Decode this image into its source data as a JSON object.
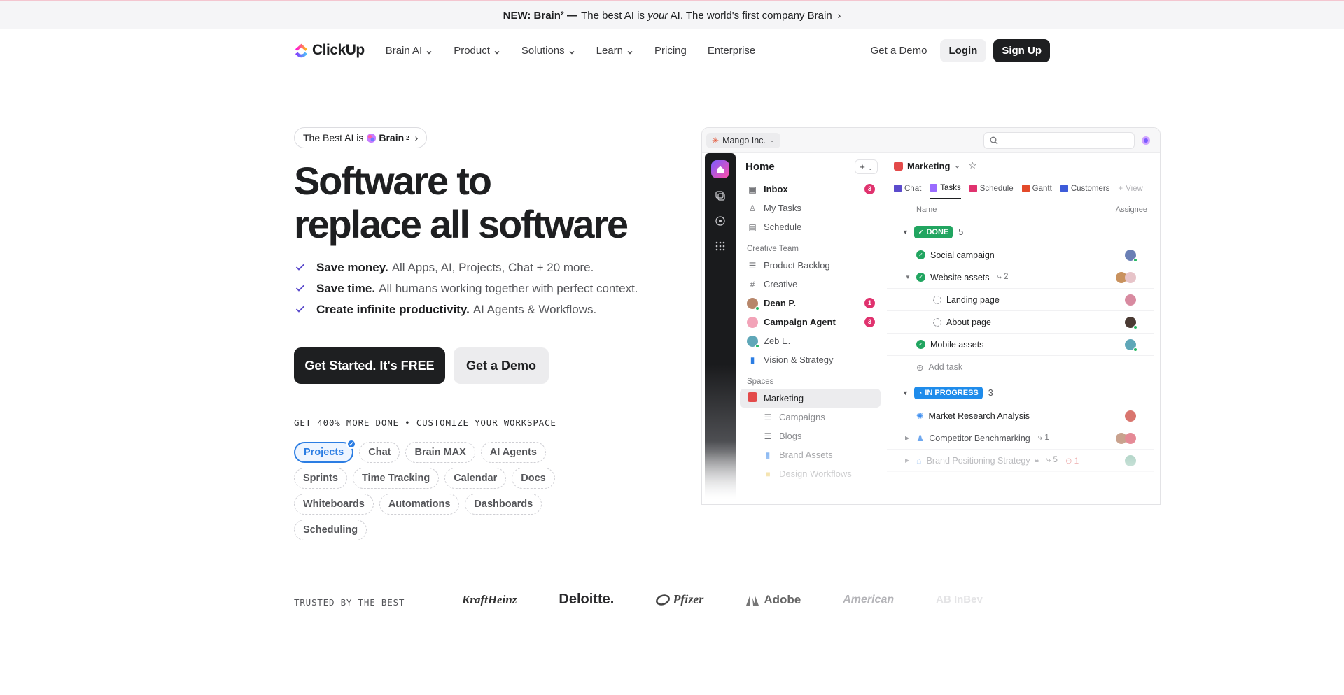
{
  "announcement": {
    "lead": "NEW: Brain² —",
    "text_before": "The best AI is",
    "text_em": "your",
    "text_after": "AI. The world's first company Brain"
  },
  "nav": {
    "logo": "ClickUp",
    "items": [
      {
        "label": "Brain AI",
        "has_caret": true
      },
      {
        "label": "Product",
        "has_caret": true
      },
      {
        "label": "Solutions",
        "has_caret": true
      },
      {
        "label": "Learn",
        "has_caret": true
      },
      {
        "label": "Pricing",
        "has_caret": false
      },
      {
        "label": "Enterprise",
        "has_caret": false
      }
    ],
    "demo": "Get a Demo",
    "login": "Login",
    "signup": "Sign Up"
  },
  "hero": {
    "pill_prefix": "The Best AI is",
    "pill_brand": "Brain",
    "pill_sup": "2",
    "headline_1": "Software to",
    "headline_2": "replace all software",
    "features": [
      {
        "bold": "Save money.",
        "text": "All Apps, AI, Projects, Chat + 20 more."
      },
      {
        "bold": "Save time.",
        "text": "All humans working together with perfect context."
      },
      {
        "bold": "Create infinite productivity.",
        "text": "AI Agents & Workflows."
      }
    ],
    "cta_primary": "Get Started. It's FREE",
    "cta_secondary": "Get a Demo",
    "workspace_label": "GET 400% MORE DONE • CUSTOMIZE YOUR WORKSPACE",
    "chips": [
      "Projects",
      "Chat",
      "Brain MAX",
      "AI Agents",
      "Sprints",
      "Time Tracking",
      "Calendar",
      "Docs",
      "Whiteboards",
      "Automations",
      "Dashboards",
      "Scheduling"
    ]
  },
  "trusted": {
    "label": "TRUSTED BY THE BEST",
    "logos": [
      "KraftHeinz",
      "Deloitte.",
      "Pfizer",
      "Adobe",
      "American",
      "AB InBev"
    ]
  },
  "app": {
    "workspace": "Mango Inc.",
    "sidebar": {
      "title": "Home",
      "top_items": [
        {
          "label": "Inbox",
          "count": "3",
          "bold": true
        },
        {
          "label": "My Tasks"
        },
        {
          "label": "Schedule"
        }
      ],
      "team_label": "Creative Team",
      "team_items": [
        {
          "label": "Product Backlog"
        },
        {
          "label": "Creative"
        },
        {
          "label": "Dean P.",
          "count": "1",
          "bold": true
        },
        {
          "label": "Campaign Agent",
          "count": "3",
          "bold": true
        },
        {
          "label": "Zeb E."
        },
        {
          "label": "Vision & Strategy"
        }
      ],
      "spaces_label": "Spaces",
      "space_items": [
        {
          "label": "Marketing"
        },
        {
          "label": "Campaigns"
        },
        {
          "label": "Blogs"
        },
        {
          "label": "Brand Assets"
        },
        {
          "label": "Design Workflows"
        }
      ]
    },
    "main": {
      "title": "Marketing",
      "tabs": [
        "Chat",
        "Tasks",
        "Schedule",
        "Gantt",
        "Customers",
        "View"
      ],
      "col_name": "Name",
      "col_assignee": "Assignee",
      "done_label": "DONE",
      "done_count": "5",
      "done_tasks": [
        {
          "name": "Social campaign"
        },
        {
          "name": "Website assets",
          "subtasks": "2"
        },
        {
          "name": "Landing page"
        },
        {
          "name": "About page"
        },
        {
          "name": "Mobile assets"
        }
      ],
      "add_task": "Add task",
      "progress_label": "IN PROGRESS",
      "progress_count": "3",
      "progress_tasks": [
        {
          "name": "Market Research Analysis"
        },
        {
          "name": "Competitor Benchmarking",
          "subtasks": "1"
        },
        {
          "name": "Brand Positioning Strategy",
          "subtasks": "5",
          "flags": "1"
        }
      ]
    }
  },
  "colors": {
    "accent": "#5b4bcc",
    "brand_blue": "#2b7de3",
    "done_green": "#21a560",
    "progress_blue": "#1f8ceb",
    "badge_pink": "#e0326e"
  }
}
